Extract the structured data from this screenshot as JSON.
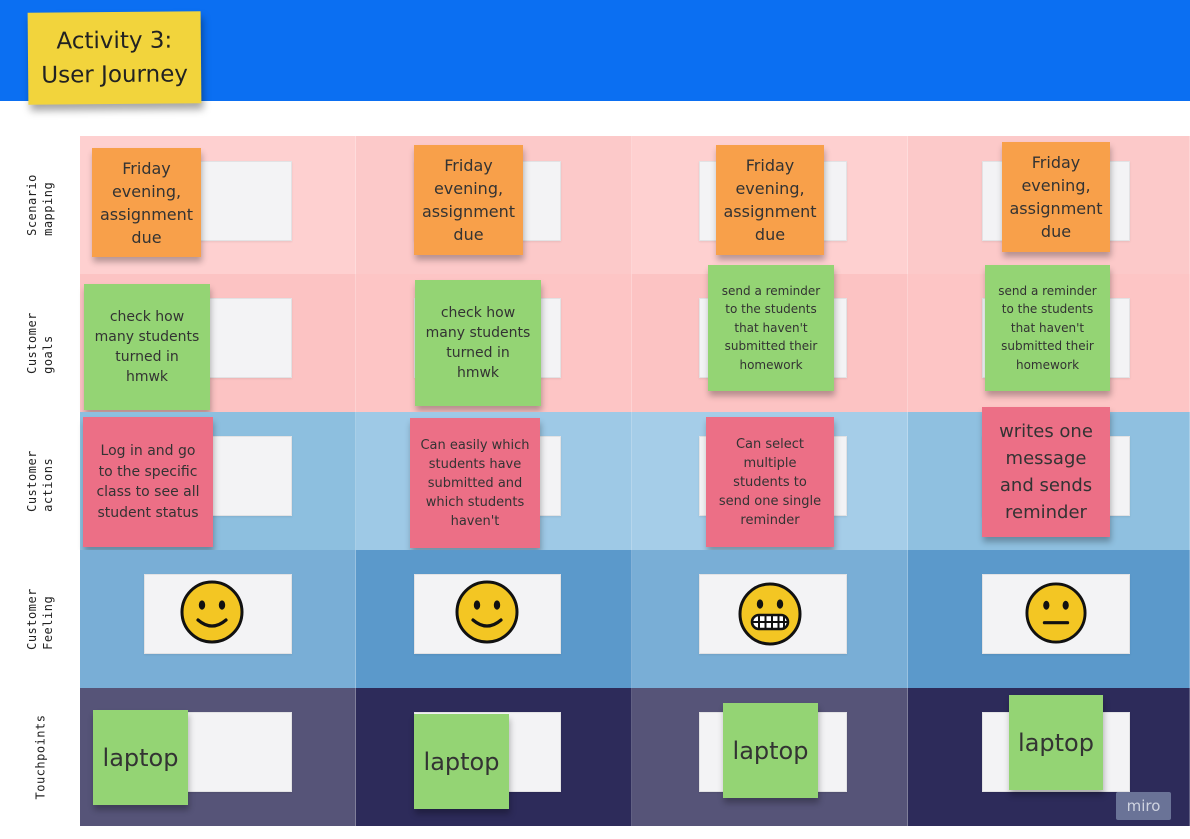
{
  "title": "Activity 3:\nUser Journey",
  "colors": {
    "banner": "#0b6ff2",
    "title_note": "#f2d43c",
    "orange_note": "#f8a04a",
    "green_note": "#94d474",
    "pink_note": "#ec6f86",
    "card": "#f3f3f5",
    "emoji_yellow": "#f3c623"
  },
  "rows": [
    {
      "label": "Scenario\nmapping",
      "colors": [
        "#fed0d0",
        "#fcc9c9",
        "#fed0d0",
        "#fcc9c9"
      ]
    },
    {
      "label": "Customer\ngoals",
      "colors": [
        "#fcc3c3",
        "#fdc5c5",
        "#fcc3c3",
        "#fdc5c5"
      ]
    },
    {
      "label": "Customer\nactions",
      "colors": [
        "#8dbfdf",
        "#9ec9e6",
        "#a5cde8",
        "#8fc0e0"
      ]
    },
    {
      "label": "Customer\nFeeling",
      "colors": [
        "#79aed6",
        "#5b99cb",
        "#79aed6",
        "#5b99cb"
      ]
    },
    {
      "label": "Touchpoints",
      "colors": [
        "#565478",
        "#2d2b5a",
        "#565478",
        "#2d2b5a"
      ]
    }
  ],
  "notes": {
    "scenario": [
      {
        "text": "Friday evening, assignment due",
        "color": "orange"
      },
      {
        "text": "Friday evening, assignment due",
        "color": "orange"
      },
      {
        "text": "Friday evening, assignment due",
        "color": "orange"
      },
      {
        "text": "Friday evening, assignment due",
        "color": "orange"
      }
    ],
    "goals": [
      {
        "text": "check how many students turned in hmwk",
        "color": "green"
      },
      {
        "text": "check how many students turned in hmwk",
        "color": "green"
      },
      {
        "text": "send a reminder to the students that haven't submitted their homework",
        "color": "green"
      },
      {
        "text": "send a reminder to the students that haven't submitted their homework",
        "color": "green"
      }
    ],
    "actions": [
      {
        "text": "Log in and go to the specific class to see all student status",
        "color": "pink"
      },
      {
        "text": "Can easily which students have submitted and which students haven't",
        "color": "pink"
      },
      {
        "text": "Can select multiple students to send one single reminder",
        "color": "pink"
      },
      {
        "text": "writes one message and sends reminder",
        "color": "pink"
      }
    ],
    "feelings": [
      {
        "icon": "slightly-smiling-face-icon"
      },
      {
        "icon": "slightly-smiling-face-icon"
      },
      {
        "icon": "grimacing-face-icon"
      },
      {
        "icon": "neutral-face-icon"
      }
    ],
    "touchpoints": [
      {
        "text": "laptop",
        "color": "green"
      },
      {
        "text": "laptop",
        "color": "green"
      },
      {
        "text": "laptop",
        "color": "green"
      },
      {
        "text": "laptop",
        "color": "green"
      }
    ]
  },
  "watermark": "miro"
}
